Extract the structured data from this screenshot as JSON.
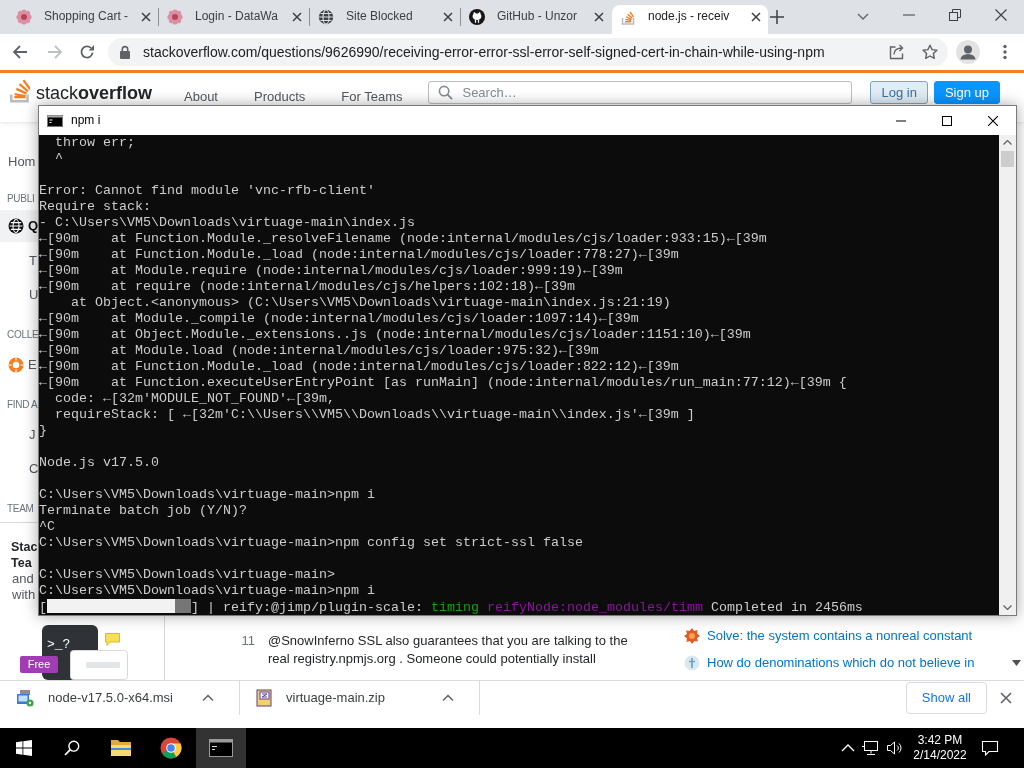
{
  "browser": {
    "tabs": [
      {
        "title": "Shopping Cart -",
        "kind": "flower",
        "selected": false
      },
      {
        "title": "Login - DataWa",
        "kind": "flower",
        "selected": false
      },
      {
        "title": "Site Blocked",
        "kind": "globe",
        "selected": false
      },
      {
        "title": "GitHub - Unzor",
        "kind": "cat",
        "selected": false
      },
      {
        "title": "node.js - receiv",
        "kind": "stack",
        "selected": true
      }
    ],
    "forward_disabled": true,
    "url": "stackoverflow.com/questions/9626990/receiving-error-error-ssl-error-self-signed-cert-in-chain-while-using-npm"
  },
  "site_header": {
    "logo": "stack**overflow**",
    "nav": [
      "About",
      "Products",
      "For Teams"
    ],
    "search": {
      "placeholder": "Search…"
    },
    "log_in": "Log in",
    "sign_up": "Sign up"
  },
  "sidebar": {
    "items": [
      {
        "kind": "top",
        "label": "Hom",
        "selected": false
      },
      {
        "kind": "heading",
        "label": "PUBLI"
      },
      {
        "kind": "globe",
        "label": "Q",
        "selected": true
      },
      {
        "kind": "link",
        "label": "T",
        "selected": false
      },
      {
        "kind": "link",
        "label": "U",
        "selected": false
      },
      {
        "kind": "heading",
        "label": "COLLE"
      },
      {
        "kind": "collective",
        "label": "E",
        "selected": false
      },
      {
        "kind": "heading",
        "label": "FIND A"
      },
      {
        "kind": "link",
        "label": "J",
        "selected": false
      },
      {
        "kind": "link",
        "label": "C",
        "selected": false
      },
      {
        "kind": "heading",
        "label": "TEAM"
      }
    ],
    "teams": {
      "title_lines": [
        "Stac",
        "Tea"
      ],
      "text_lines": [
        "and",
        "with"
      ],
      "prompt": ">_?",
      "badge": "Free"
    }
  },
  "terminal": {
    "title": "npm i",
    "blocks": [
      [
        "  throw err;",
        "  ^"
      ],
      [
        "Error: Cannot find module 'vnc-rfb-client'",
        "Require stack:",
        "- C:\\Users\\VM5\\Downloads\\virtuage-main\\index.js",
        "←[90m    at Function.Module._resolveFilename (node:internal/modules/cjs/loader:933:15)←[39m",
        "←[90m    at Function.Module._load (node:internal/modules/cjs/loader:778:27)←[39m",
        "←[90m    at Module.require (node:internal/modules/cjs/loader:999:19)←[39m",
        "←[90m    at require (node:internal/modules/cjs/helpers:102:18)←[39m",
        "    at Object.<anonymous> (C:\\Users\\VM5\\Downloads\\virtuage-main\\index.js:21:19)",
        "←[90m    at Module._compile (node:internal/modules/cjs/loader:1097:14)←[39m",
        "←[90m    at Object.Module._extensions..js (node:internal/modules/cjs/loader:1151:10)←[39m",
        "←[90m    at Module.load (node:internal/modules/cjs/loader:975:32)←[39m",
        "←[90m    at Function.Module._load (node:internal/modules/cjs/loader:822:12)←[39m",
        "←[90m    at Function.executeUserEntryPoint [as runMain] (node:internal/modules/run_main:77:12)←[39m {",
        "  code: ←[32m'MODULE_NOT_FOUND'←[39m,",
        "  requireStack: [ ←[32m'C:\\\\Users\\\\VM5\\\\Downloads\\\\virtuage-main\\\\index.js'←[39m ]",
        "}"
      ],
      [
        "Node.js v17.5.0"
      ],
      [
        "C:\\Users\\VM5\\Downloads\\virtuage-main>npm i",
        "Terminate batch job (Y/N)?",
        "^C",
        "C:\\Users\\VM5\\Downloads\\virtuage-main>npm config set strict-ssl false"
      ],
      [
        "C:\\Users\\VM5\\Downloads\\virtuage-main>",
        "C:\\Users\\VM5\\Downloads\\virtuage-main>npm i"
      ]
    ],
    "progress_line": {
      "bracket_open": "[",
      "level": 0.89,
      "bracket_close": "]",
      "segments": [
        {
          "text": "| reify:@jimp/plugin-scale:",
          "color": "#cccccc"
        },
        {
          "text": "timing",
          "color": "#13a10e"
        },
        {
          "text": "reifyNode:node_modules/timm",
          "color": "#881798"
        },
        {
          "text": "Completed in 2456ms",
          "color": "#cccccc"
        }
      ]
    }
  },
  "comment": {
    "score": "11",
    "text": "@SnowInferno SSL also guarantees that you are talking to the real registry.npmjs.org . Someone could potentially install"
  },
  "hot_questions": [
    {
      "kind": "burst",
      "title": "Solve: the system contains a nonreal constant"
    },
    {
      "kind": "cross",
      "title": "How do denominations which do not believe in"
    }
  ],
  "downloads": {
    "files": [
      {
        "kind": "installer",
        "name": "node-v17.5.0-x64.msi"
      },
      {
        "kind": "archive",
        "name": "virtuage-main.zip"
      }
    ],
    "show_all": "Show all"
  },
  "taskbar": {
    "apps": [
      {
        "kind": "folder",
        "selected": false
      },
      {
        "kind": "browser",
        "selected": false
      },
      {
        "kind": "console",
        "selected": true
      }
    ],
    "time": "3:42 PM",
    "date": "2/14/2022"
  }
}
